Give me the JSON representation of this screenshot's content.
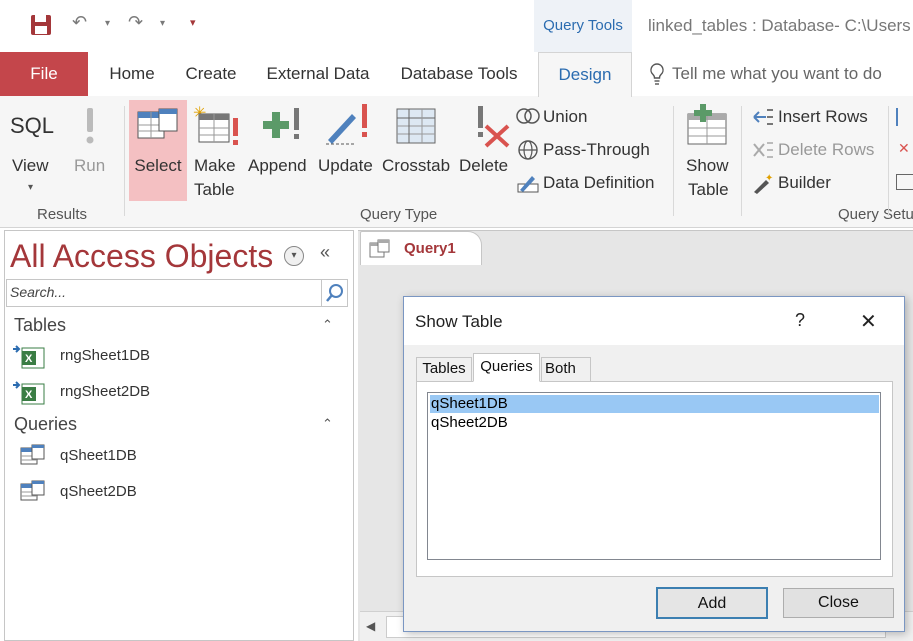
{
  "window": {
    "context_tab": "Query Tools",
    "title": "linked_tables : Database- C:\\Users"
  },
  "tabs": {
    "file": "File",
    "home": "Home",
    "create": "Create",
    "external_data": "External Data",
    "database_tools": "Database Tools",
    "design": "Design",
    "tell_me": "Tell me what you want to do"
  },
  "ribbon": {
    "results": {
      "sql": "SQL",
      "view": "View",
      "run": "Run",
      "group": "Results"
    },
    "query_type": {
      "select": "Select",
      "make_table_1": "Make",
      "make_table_2": "Table",
      "append": "Append",
      "update": "Update",
      "crosstab": "Crosstab",
      "delete": "Delete",
      "union": "Union",
      "pass_through": "Pass-Through",
      "data_definition": "Data Definition",
      "group": "Query Type"
    },
    "query_setup": {
      "show_table_1": "Show",
      "show_table_2": "Table",
      "insert_rows": "Insert Rows",
      "delete_rows": "Delete Rows",
      "builder": "Builder",
      "group": "Query Setu"
    }
  },
  "nav": {
    "title": "All Access Objects",
    "search_placeholder": "Search...",
    "tables_header": "Tables",
    "tables": [
      "rngSheet1DB",
      "rngSheet2DB"
    ],
    "queries_header": "Queries",
    "queries": [
      "qSheet1DB",
      "qSheet2DB"
    ]
  },
  "document_tab": {
    "label": "Query1"
  },
  "dialog": {
    "title": "Show Table",
    "help": "?",
    "close_x": "✕",
    "tabs": [
      "Tables",
      "Queries",
      "Both"
    ],
    "active_tab": "Queries",
    "items": [
      "qSheet1DB",
      "qSheet2DB"
    ],
    "selected_item": "qSheet1DB",
    "add_button": "Add",
    "close_button": "Close"
  },
  "colors": {
    "access_accent": "#a4373a",
    "file_tab_bg": "#c4464b",
    "context_tab_text": "#2b6cb0",
    "selected_button_bg": "#f4c0c2",
    "list_selection": "#99c8f4"
  }
}
